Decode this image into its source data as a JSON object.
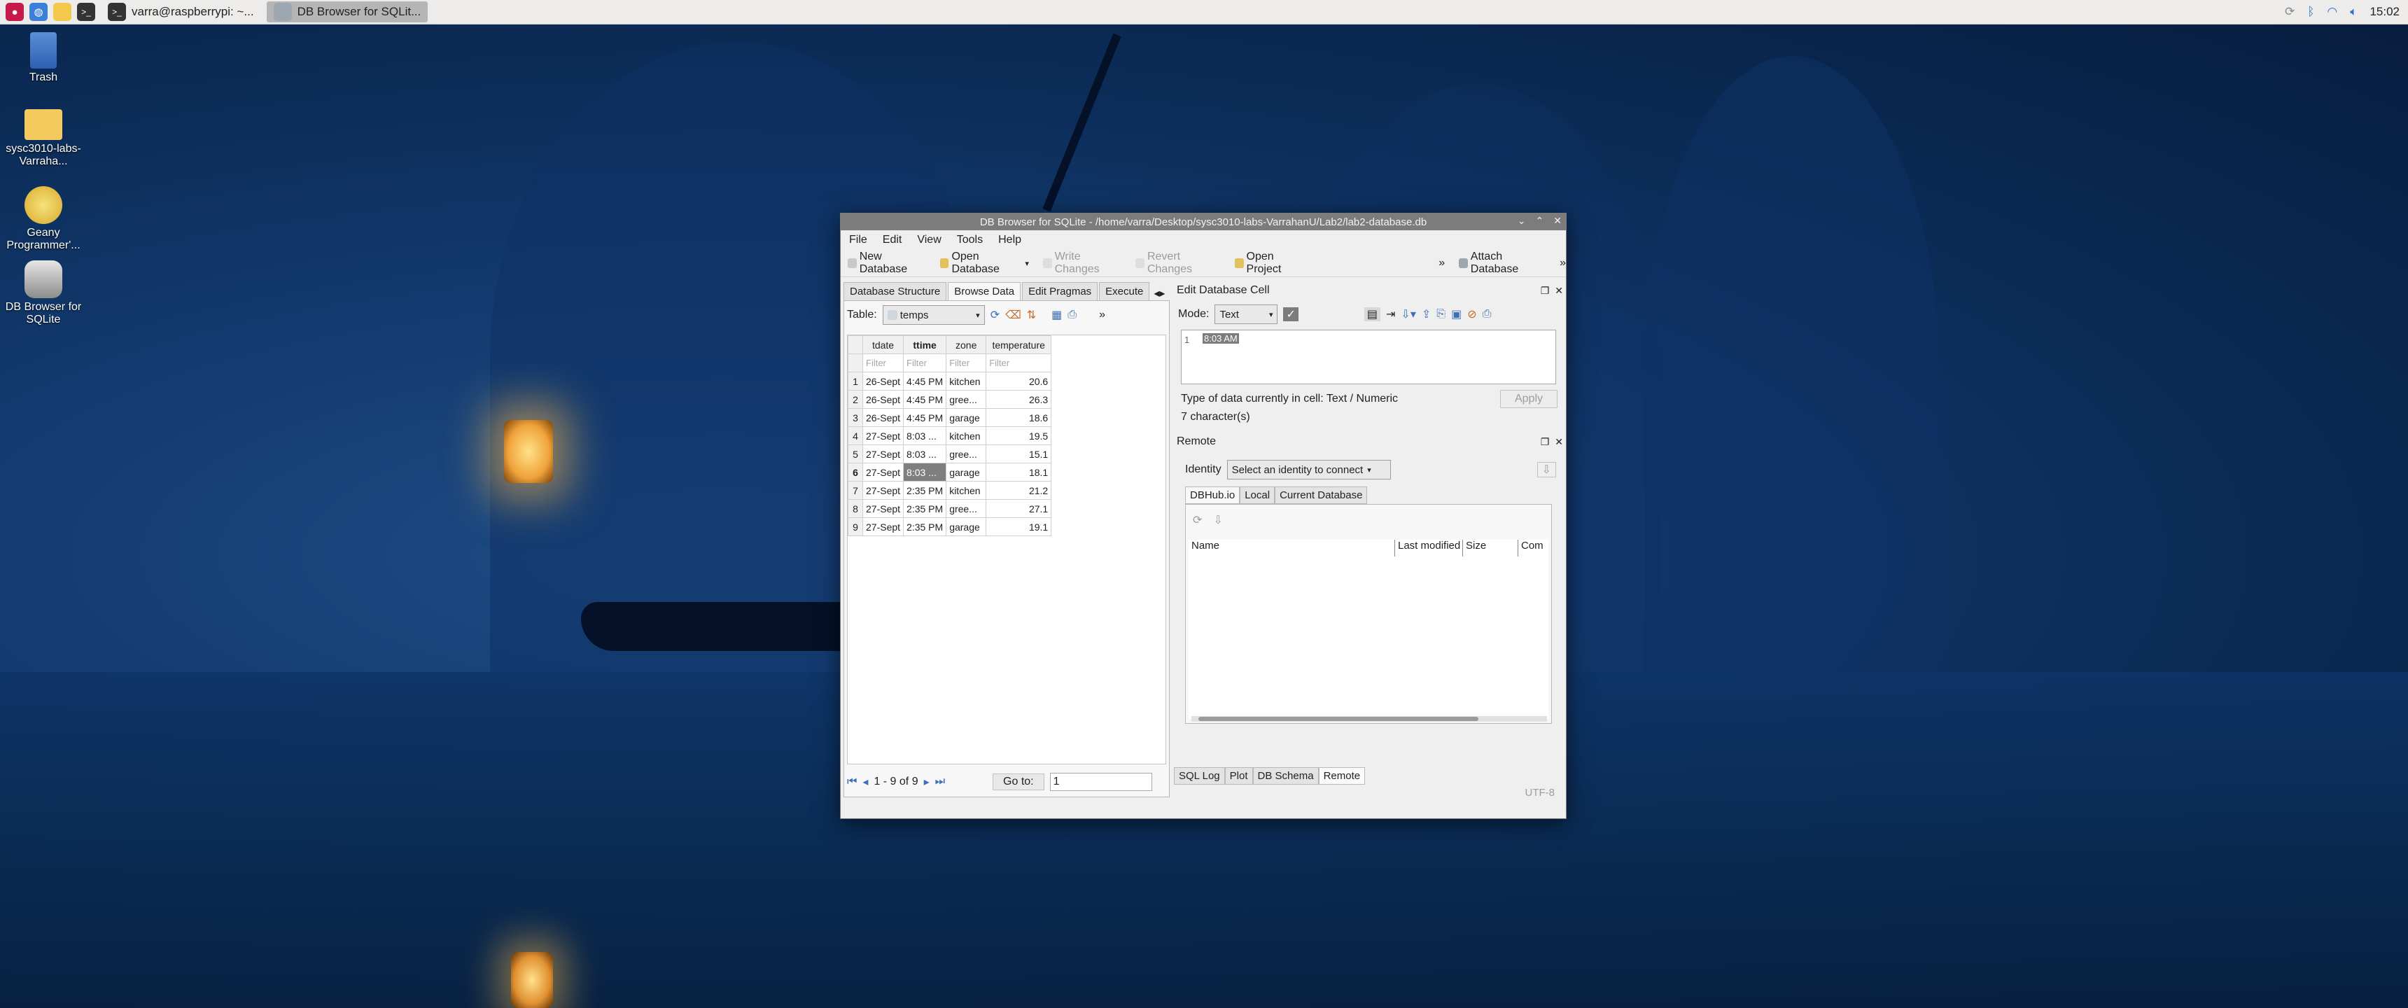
{
  "taskbar": {
    "tasks": [
      {
        "label": "varra@raspberrypi: ~..."
      },
      {
        "label": "DB Browser for SQLit..."
      }
    ],
    "clock": "15:02"
  },
  "desktop": {
    "icons": [
      {
        "label": "Trash"
      },
      {
        "label": "sysc3010-labs-Varraha..."
      },
      {
        "label": "Geany Programmer'..."
      },
      {
        "label": "DB Browser for SQLite"
      }
    ]
  },
  "window": {
    "title": "DB Browser for SQLite - /home/varra/Desktop/sysc3010-labs-VarrahanU/Lab2/lab2-database.db",
    "menu": [
      "File",
      "Edit",
      "View",
      "Tools",
      "Help"
    ],
    "toolbar": {
      "new_db": "New Database",
      "open_db": "Open Database",
      "write": "Write Changes",
      "revert": "Revert Changes",
      "open_project": "Open Project",
      "attach": "Attach Database",
      "more": "»"
    },
    "tabs": [
      "Database Structure",
      "Browse Data",
      "Edit Pragmas",
      "Execute"
    ],
    "table_label": "Table:",
    "table_name": "temps",
    "columns": [
      "tdate",
      "ttime",
      "zone",
      "temperature"
    ],
    "filter_text": "Filter",
    "rows": [
      {
        "n": "1",
        "tdate": "26-Sept",
        "ttime": "4:45 PM",
        "zone": "kitchen",
        "temperature": "20.6"
      },
      {
        "n": "2",
        "tdate": "26-Sept",
        "ttime": "4:45 PM",
        "zone": "gree...",
        "temperature": "26.3"
      },
      {
        "n": "3",
        "tdate": "26-Sept",
        "ttime": "4:45 PM",
        "zone": "garage",
        "temperature": "18.6"
      },
      {
        "n": "4",
        "tdate": "27-Sept",
        "ttime": "8:03 ...",
        "zone": "kitchen",
        "temperature": "19.5"
      },
      {
        "n": "5",
        "tdate": "27-Sept",
        "ttime": "8:03 ...",
        "zone": "gree...",
        "temperature": "15.1"
      },
      {
        "n": "6",
        "tdate": "27-Sept",
        "ttime": "8:03 ...",
        "zone": "garage",
        "temperature": "18.1"
      },
      {
        "n": "7",
        "tdate": "27-Sept",
        "ttime": "2:35 PM",
        "zone": "kitchen",
        "temperature": "21.2"
      },
      {
        "n": "8",
        "tdate": "27-Sept",
        "ttime": "2:35 PM",
        "zone": "gree...",
        "temperature": "27.1"
      },
      {
        "n": "9",
        "tdate": "27-Sept",
        "ttime": "2:35 PM",
        "zone": "garage",
        "temperature": "19.1"
      }
    ],
    "pager": {
      "count": "1 - 9 of 9",
      "goto_label": "Go to:",
      "goto_value": "1"
    },
    "edit_cell": {
      "title": "Edit Database Cell",
      "mode_label": "Mode:",
      "mode_value": "Text",
      "line_no": "1",
      "value": "8:03 AM",
      "type_info": "Type of data currently in cell: Text / Numeric",
      "size_info": "7 character(s)",
      "apply": "Apply"
    },
    "remote": {
      "title": "Remote",
      "identity_label": "Identity",
      "identity_value": "Select an identity to connect",
      "tabs": [
        "DBHub.io",
        "Local",
        "Current Database"
      ],
      "columns": [
        "Name",
        "Last modified",
        "Size",
        "Com"
      ]
    },
    "bottom_tabs": [
      "SQL Log",
      "Plot",
      "DB Schema",
      "Remote"
    ],
    "encoding": "UTF-8"
  },
  "colors": {
    "accent": "#7f7f7f",
    "title_bar": "#7c7c7c"
  }
}
